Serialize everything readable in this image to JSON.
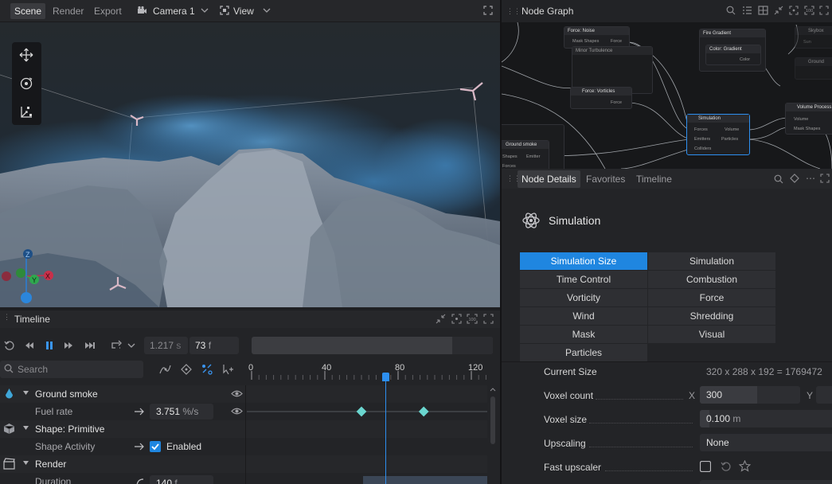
{
  "viewport_toolbar": {
    "tabs": [
      "Scene",
      "Render",
      "Export"
    ],
    "camera": "Camera 1",
    "view": "View"
  },
  "timeline": {
    "title": "Timeline",
    "time_seconds": "1.217",
    "time_unit": "s",
    "frame": "73",
    "frame_unit": "f",
    "search_placeholder": "Search",
    "ruler_ticks": [
      "0",
      "40",
      "80",
      "120"
    ],
    "current_frame": 73,
    "rows": [
      {
        "label": "Ground smoke",
        "type": "group"
      },
      {
        "label": "Fuel rate",
        "type": "property",
        "value": "3.751",
        "unit": "%/s"
      },
      {
        "label": "Shape: Primitive",
        "type": "group"
      },
      {
        "label": "Shape Activity",
        "type": "property",
        "value": "Enabled"
      },
      {
        "label": "Render",
        "type": "group"
      },
      {
        "label": "Duration",
        "type": "property",
        "value": "140",
        "unit": "f"
      }
    ],
    "keyframes": [
      60,
      94
    ]
  },
  "node_graph": {
    "title": "Node Graph",
    "nodes": {
      "noise": {
        "title": "Force: Noise",
        "ports": [
          "Mask Shapes",
          "Force"
        ]
      },
      "minor": {
        "title": "Minor Turbulence"
      },
      "fire": {
        "title": "Fire Gradient"
      },
      "gradient": {
        "title": "Color: Gradient",
        "ports": [
          "Color"
        ]
      },
      "skybox": {
        "title": "Skybox",
        "ports": [
          "Sun"
        ]
      },
      "ground": {
        "title": "Ground"
      },
      "vorticles": {
        "title": "Force: Vorticles",
        "ports": [
          "Force"
        ]
      },
      "simulation": {
        "title": "Simulation",
        "ports": [
          "Forces",
          "Emitters",
          "Colliders",
          "Volume",
          "Particles"
        ]
      },
      "volume": {
        "title": "Volume Process",
        "ports": [
          "Volume",
          "Mask Shapes"
        ]
      },
      "groundsmoke": {
        "title": "Ground smoke",
        "ports": [
          "Shapes",
          "Emitter",
          "Forces"
        ]
      }
    }
  },
  "details": {
    "tabs": [
      "Node Details",
      "Favorites",
      "Timeline"
    ],
    "title": "Simulation",
    "categories": [
      "Simulation Size",
      "Simulation",
      "Time Control",
      "Combustion",
      "Vorticity",
      "Force",
      "Wind",
      "Shredding",
      "Mask",
      "Visual",
      "Particles"
    ],
    "props": {
      "current_size_label": "Current Size",
      "current_size_value": "320 x 288 x 192 = 1769472",
      "voxel_count_label": "Voxel count",
      "voxel_x_label": "X",
      "voxel_x": "300",
      "voxel_y_label": "Y",
      "voxel_size_label": "Voxel size",
      "voxel_size_value": "0.100",
      "voxel_size_unit": "m",
      "upscaling_label": "Upscaling",
      "upscaling_value": "None",
      "fast_upscaler_label": "Fast upscaler"
    }
  },
  "colors": {
    "accent": "#1f86e0",
    "keyframe": "#6ad6cf",
    "axis_x": "#c8304a",
    "axis_y": "#2fa84f",
    "axis_z": "#2a7fd6"
  }
}
